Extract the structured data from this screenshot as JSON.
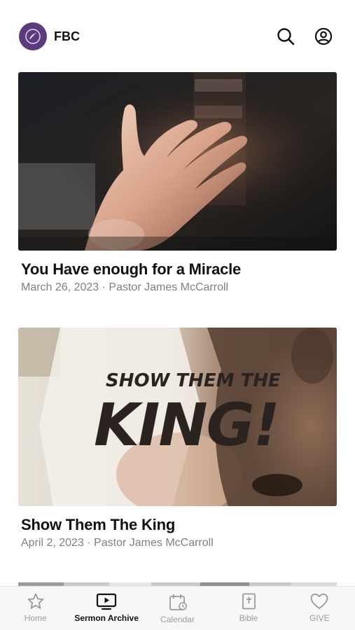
{
  "header": {
    "brand": "FBC",
    "brand_color": "#5b3a7e"
  },
  "sermons": [
    {
      "title": "You Have enough for a Miracle",
      "meta": "March 26, 2023 · Pastor James McCarroll"
    },
    {
      "title": "Show Them The King",
      "meta": "April 2, 2023 · Pastor James McCarroll",
      "artwork_text_line1": "SHOW THEM THE",
      "artwork_text_line2": "KING!"
    }
  ],
  "tabbar": {
    "items": [
      {
        "label": "Home",
        "icon": "star-icon"
      },
      {
        "label": "Sermon Archive",
        "icon": "tv-play-icon"
      },
      {
        "label": "Calendar",
        "icon": "calendar-icon"
      },
      {
        "label": "Bible",
        "icon": "bible-icon"
      },
      {
        "label": "GIVE",
        "icon": "heart-icon"
      }
    ],
    "active": "Sermon Archive"
  }
}
